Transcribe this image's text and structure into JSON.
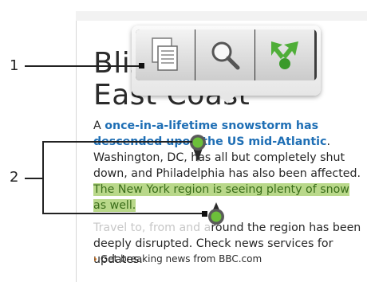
{
  "callouts": {
    "one": "1",
    "two": "2"
  },
  "article": {
    "title": "Blizzard hits US East Coast",
    "lead_prefix": "A ",
    "link_text": "once-in-a-lifetime snowstorm has descended upon the US mid-Atlantic",
    "after_link": ". Washington, DC, has all but completely shut down, and Philadelphia has also been affected. ",
    "selected_text": "The New York region is seeing plenty of snow as well.",
    "p2_faded": "Travel to, from and a",
    "p2_rest": "round the region has been deeply disrupted. Check news services for updates."
  },
  "bbc_link": "Get breaking news from BBC.com",
  "popup": {
    "tools": [
      {
        "name": "copy",
        "icon": "copy-icon"
      },
      {
        "name": "search",
        "icon": "search-icon"
      },
      {
        "name": "share",
        "icon": "share-icon"
      }
    ]
  },
  "colors": {
    "link": "#1f6fb5",
    "selection": "#b9d88a",
    "handle": "#6cbf3a",
    "bullet": "#e07a1f"
  }
}
